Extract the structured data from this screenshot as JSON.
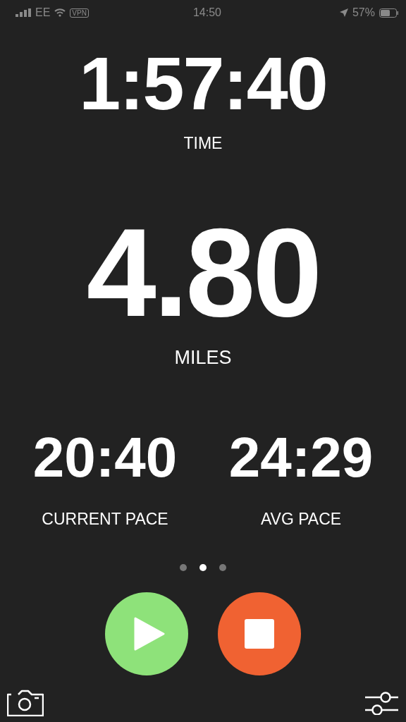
{
  "status_bar": {
    "carrier": "EE",
    "vpn": "VPN",
    "time": "14:50",
    "battery": "57%"
  },
  "time": {
    "value": "1:57:40",
    "label": "TIME"
  },
  "distance": {
    "value": "4.80",
    "label": "MILES"
  },
  "paces": [
    {
      "value": "20:40",
      "label": "CURRENT PACE"
    },
    {
      "value": "24:29",
      "label": "AVG PACE"
    }
  ],
  "pages": [
    {
      "selected": false
    },
    {
      "selected": true
    },
    {
      "selected": false
    }
  ]
}
